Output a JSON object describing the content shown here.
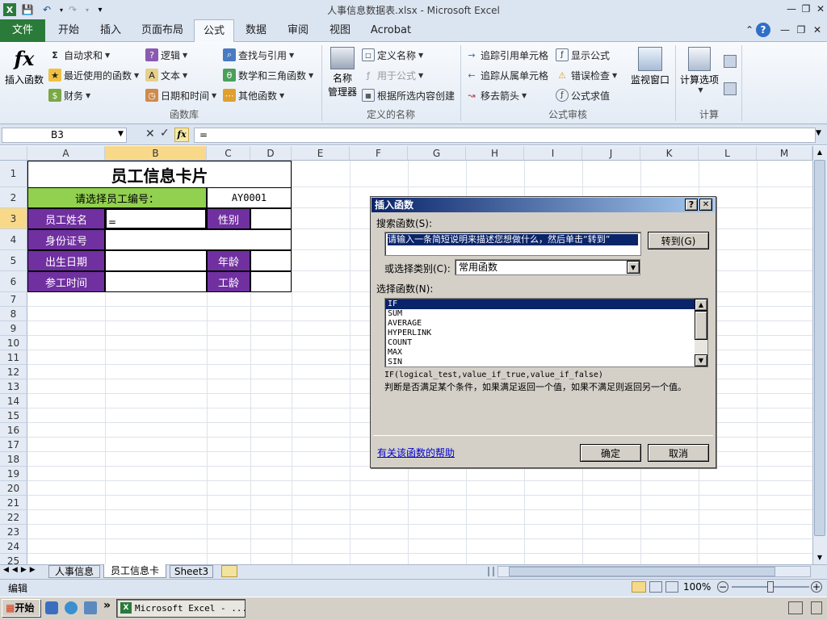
{
  "title_bar": {
    "title": "人事信息数据表.xlsx - Microsoft Excel"
  },
  "tabs": [
    {
      "label": "文件"
    },
    {
      "label": "开始"
    },
    {
      "label": "插入"
    },
    {
      "label": "页面布局"
    },
    {
      "label": "公式"
    },
    {
      "label": "数据"
    },
    {
      "label": "审阅"
    },
    {
      "label": "视图"
    },
    {
      "label": "Acrobat"
    }
  ],
  "ribbon": {
    "insert_function": {
      "icon": "fx",
      "label": "插入函数"
    },
    "library": {
      "label": "函数库",
      "items": [
        "自动求和",
        "最近使用的函数",
        "财务",
        "逻辑",
        "文本",
        "日期和时间",
        "查找与引用",
        "数学和三角函数",
        "其他函数"
      ]
    },
    "names": {
      "label": "定义的名称",
      "manager_line1": "名称",
      "manager_line2": "管理器",
      "items": [
        "定义名称",
        "用于公式",
        "根据所选内容创建"
      ]
    },
    "audit": {
      "label": "公式审核",
      "items": [
        "追踪引用单元格",
        "追踪从属单元格",
        "移去箭头",
        "显示公式",
        "错误检查",
        "公式求值"
      ],
      "watch": "监视窗口"
    },
    "calc": {
      "label": "计算",
      "options": "计算选项"
    }
  },
  "formula_bar": {
    "name_box": "B3",
    "fx": "fx",
    "content": "="
  },
  "columns": [
    "A",
    "B",
    "C",
    "D",
    "E",
    "F",
    "G",
    "H",
    "I",
    "J",
    "K",
    "L",
    "M"
  ],
  "rows": [
    "1",
    "2",
    "3",
    "4",
    "5",
    "6",
    "7",
    "8",
    "9",
    "10",
    "11",
    "12",
    "13",
    "14",
    "15",
    "16",
    "17",
    "18",
    "19",
    "20",
    "21",
    "22",
    "23",
    "24",
    "25"
  ],
  "card": {
    "title": "员工信息卡片",
    "select_prompt": "请选择员工编号：",
    "employee_id": "AY0001",
    "name_label": "员工姓名",
    "name_value": "=",
    "gender_label": "性别",
    "id_label": "身份证号",
    "birth_label": "出生日期",
    "age_label": "年龄",
    "join_label": "参工时间",
    "tenure_label": "工龄"
  },
  "dialog": {
    "title": "插入函数",
    "help_icon": "?",
    "close_icon": "✕",
    "search_label": "搜索函数(S):",
    "search_value": "请输入一条简短说明来描述您想做什么，然后单击“转到”",
    "go_button": "转到(G)",
    "category_label": "或选择类别(C):",
    "category_value": "常用函数",
    "select_label": "选择函数(N):",
    "functions": [
      "IF",
      "SUM",
      "AVERAGE",
      "HYPERLINK",
      "COUNT",
      "MAX",
      "SIN"
    ],
    "signature": "IF(logical_test,value_if_true,value_if_false)",
    "description": "判断是否满足某个条件，如果满足返回一个值，如果不满足则返回另一个值。",
    "help_link": "有关该函数的帮助",
    "ok": "确定",
    "cancel": "取消"
  },
  "sheets": [
    {
      "label": "人事信息"
    },
    {
      "label": "员工信息卡"
    },
    {
      "label": "Sheet3"
    }
  ],
  "status": {
    "mode": "编辑",
    "zoom": "100%"
  },
  "taskbar": {
    "start": "开始",
    "window": "Microsoft Excel - ..."
  },
  "colors": {
    "accent": "#2a7b3a",
    "purple": "#7030a0",
    "green": "#92d050",
    "dialog_title": "#0a246a"
  }
}
